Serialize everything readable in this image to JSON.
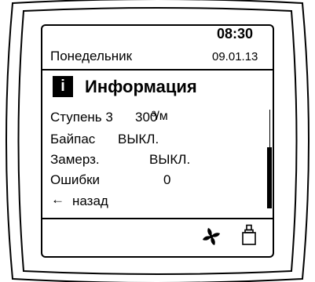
{
  "header": {
    "time": "08:30",
    "weekday": "Понедельник",
    "date": "09.01.13"
  },
  "section": {
    "icon": "info-icon",
    "title": "Информация"
  },
  "rows": [
    {
      "label": "Ступень 3",
      "value": "300",
      "unit": "³/м"
    },
    {
      "label": "Байпас",
      "value": "ВЫКЛ."
    },
    {
      "label": "Замерз.",
      "value": "ВЫКЛ."
    },
    {
      "label": "Ошибки",
      "value": "0"
    }
  ],
  "back": {
    "icon": "arrow-left-icon",
    "label": "назад"
  },
  "scrollbar": {
    "position_fraction": 0.4,
    "visible_fraction": 0.6
  },
  "footer": {
    "icons": [
      "fan-icon",
      "filter-icon"
    ]
  }
}
